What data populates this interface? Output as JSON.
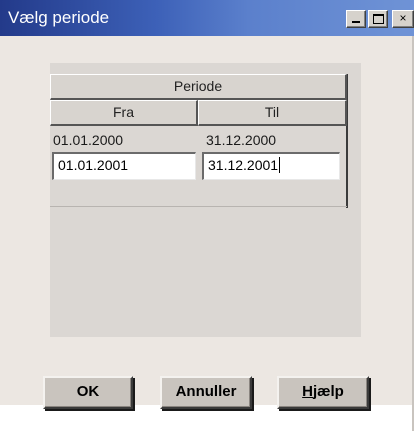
{
  "window": {
    "title": "Vælg periode",
    "controls": [
      "minimize-icon",
      "maximize-icon",
      "close-icon"
    ],
    "close_glyph": "×"
  },
  "grid": {
    "group_header": "Periode",
    "columns": [
      "Fra",
      "Til"
    ],
    "rows": [
      {
        "fra": "01.01.2000",
        "til": "31.12.2000"
      }
    ],
    "edit_row": {
      "fra": "01.01.2001",
      "til": "31.12.2001"
    }
  },
  "buttons": {
    "ok": "OK",
    "annuller": "Annuller",
    "hjaelp_mnemonic": "H",
    "hjaelp_rest": "jælp"
  },
  "colors": {
    "titlebar_start": "#233a8a",
    "titlebar_end": "#6f93d6",
    "dialog_bg": "#ece7e2",
    "panel_bg": "#dbd7d3"
  }
}
